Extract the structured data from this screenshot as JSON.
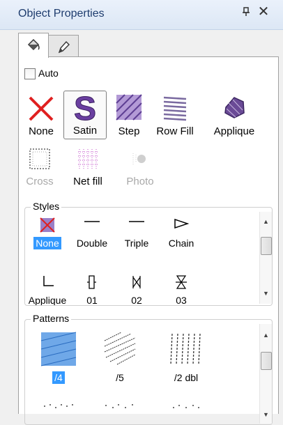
{
  "window": {
    "title": "Object Properties",
    "pin_icon": "pin-icon",
    "close_label": "✕"
  },
  "tabs": [
    {
      "name": "fill-tab",
      "icon": "paint-bucket-icon",
      "active": true
    },
    {
      "name": "outline-tab",
      "icon": "pencil-icon",
      "active": false
    }
  ],
  "auto": {
    "label": "Auto",
    "checked": false
  },
  "fill_types": [
    {
      "label": "None",
      "icon": "none-red-x-icon"
    },
    {
      "label": "Satin",
      "icon": "satin-s-icon",
      "selected": true
    },
    {
      "label": "Step",
      "icon": "step-fill-icon"
    },
    {
      "label": "Row Fill",
      "icon": "row-fill-icon"
    },
    {
      "label": "Applique",
      "icon": "applique-icon"
    },
    {
      "label": "Cross",
      "icon": "cross-stitch-icon",
      "disabled": true
    },
    {
      "label": "Net fill",
      "icon": "net-fill-icon"
    },
    {
      "label": "Photo",
      "icon": "photo-icon",
      "disabled": true
    }
  ],
  "styles": {
    "label": "Styles",
    "items": [
      {
        "label": "None",
        "icon": "none-style-icon",
        "selected": true
      },
      {
        "label": "Double",
        "icon": "double-line-icon"
      },
      {
        "label": "Triple",
        "icon": "triple-line-icon"
      },
      {
        "label": "Chain",
        "icon": "chain-icon"
      },
      {
        "label": "Applique",
        "icon": "applique-corner-icon"
      },
      {
        "label": "01",
        "icon": "style-01-icon"
      },
      {
        "label": "02",
        "icon": "style-02-icon"
      },
      {
        "label": "03",
        "icon": "style-03-icon"
      }
    ]
  },
  "patterns": {
    "label": "Patterns",
    "items": [
      {
        "label": "/4",
        "icon": "pattern-slash4-icon",
        "selected": true
      },
      {
        "label": "/5",
        "icon": "pattern-slash5-icon"
      },
      {
        "label": "/2 dbl",
        "icon": "pattern-slash2dbl-icon"
      },
      {
        "label": "",
        "icon": "pattern-dots-1-icon"
      },
      {
        "label": "",
        "icon": "pattern-dots-2-icon"
      },
      {
        "label": "",
        "icon": "pattern-dots-3-icon"
      }
    ]
  },
  "colors": {
    "accent": "#3399ff",
    "title_text": "#1e3c6e",
    "none_x": "#e02020",
    "satin_purple": "#6a3fa0"
  }
}
